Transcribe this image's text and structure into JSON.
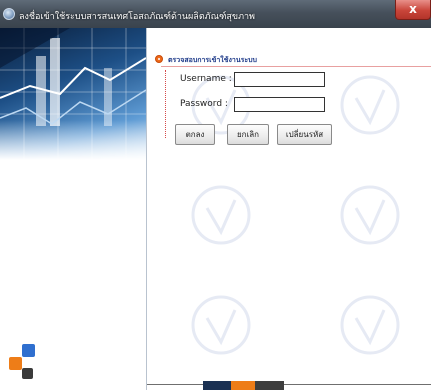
{
  "window": {
    "title": "ลงชื่อเข้าใช้ระบบสารสนเทศโอสถภัณฑ์ด้านผลิตภัณฑ์สุขภาพ",
    "close_label": "x"
  },
  "login": {
    "section_title": "ตรวจสอบการเข้าใช้งานระบบ",
    "username_label": "Username :",
    "username_value": "",
    "password_label": "Password :",
    "password_value": "",
    "buttons": {
      "ok": "ตกลง",
      "cancel": "ยกเลิก",
      "change_password": "เปลี่ยนรหัส"
    }
  },
  "colors": {
    "accent": "#1f3b8a",
    "bullet": "#ef6a1a",
    "deco_blue": "#2f6fcf",
    "deco_orange": "#ee7d18",
    "deco_dark": "#3a3a3a"
  }
}
